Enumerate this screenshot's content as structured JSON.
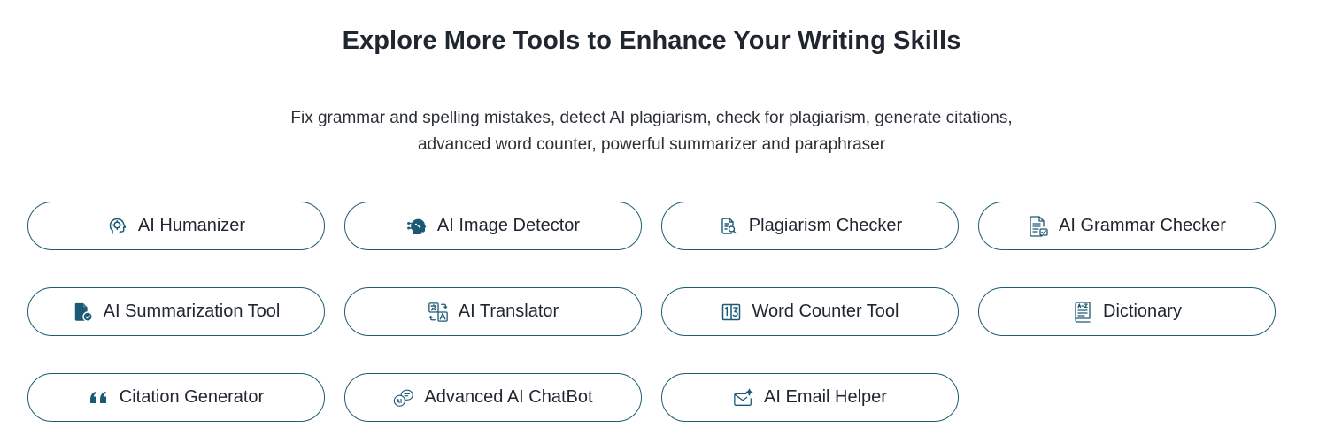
{
  "section": {
    "title": "Explore More Tools to Enhance Your Writing Skills",
    "subtitle_line1": "Fix grammar and spelling mistakes, detect AI plagiarism, check for plagiarism, generate citations,",
    "subtitle_line2": "advanced word counter, powerful summarizer and paraphraser"
  },
  "tools": [
    {
      "label": "AI Humanizer",
      "icon": "humanizer-head-icon"
    },
    {
      "label": "AI Image Detector",
      "icon": "ai-head-circuit-icon"
    },
    {
      "label": "Plagiarism Checker",
      "icon": "document-search-icon"
    },
    {
      "label": "AI Grammar Checker",
      "icon": "document-check-icon"
    },
    {
      "label": "AI Summarization Tool",
      "icon": "document-badge-icon"
    },
    {
      "label": "AI Translator",
      "icon": "translate-icon"
    },
    {
      "label": "Word Counter Tool",
      "icon": "counter-book-icon"
    },
    {
      "label": "Dictionary",
      "icon": "dictionary-book-icon"
    },
    {
      "label": "Citation Generator",
      "icon": "quote-icon"
    },
    {
      "label": "Advanced AI ChatBot",
      "icon": "ai-chat-bubble-icon"
    },
    {
      "label": "AI Email Helper",
      "icon": "email-sparkle-icon"
    }
  ],
  "colors": {
    "border": "#1f5d73",
    "icon": "#1b5a74",
    "text": "#1f2630"
  }
}
